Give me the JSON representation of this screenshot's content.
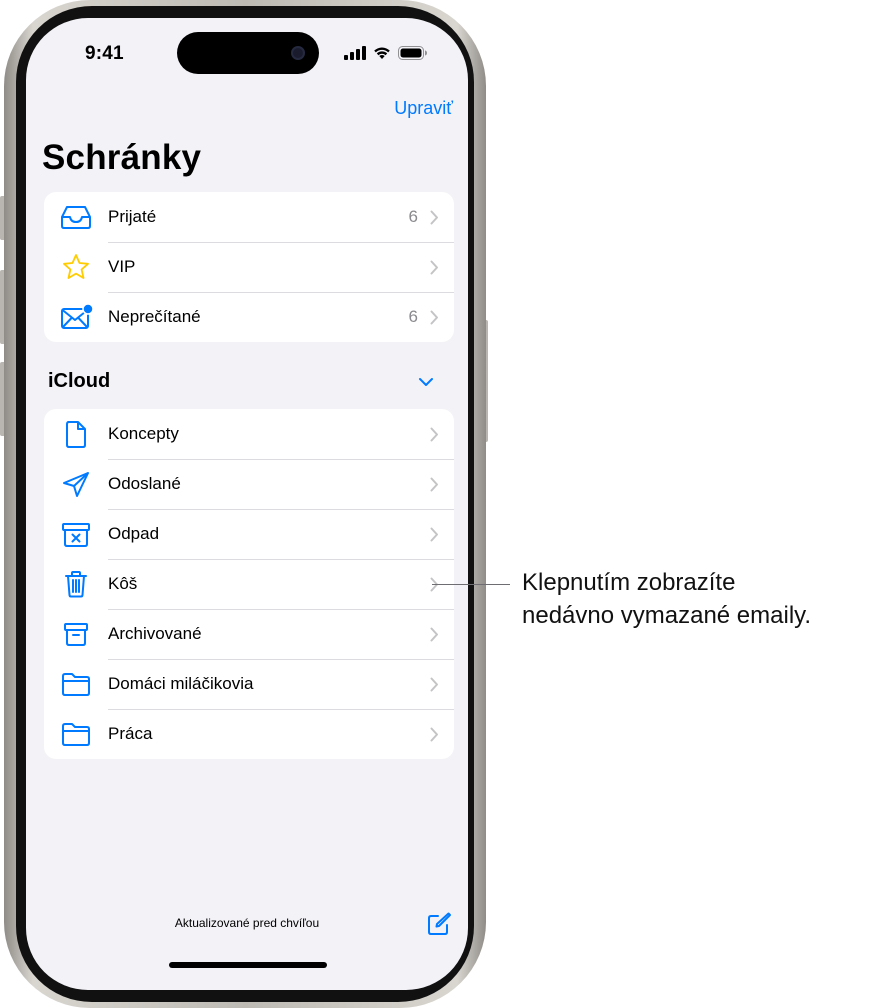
{
  "status_bar": {
    "time": "9:41"
  },
  "nav": {
    "edit_label": "Upraviť",
    "title": "Schránky"
  },
  "mailboxes": [
    {
      "label": "Prijaté",
      "count": "6",
      "icon": "inbox-tray-icon"
    },
    {
      "label": "VIP",
      "count": "",
      "icon": "star-icon"
    },
    {
      "label": "Neprečítané",
      "count": "6",
      "icon": "unread-envelope-icon"
    }
  ],
  "icloud": {
    "header": "iCloud",
    "folders": [
      {
        "label": "Koncepty",
        "icon": "draft-document-icon"
      },
      {
        "label": "Odoslané",
        "icon": "paper-plane-icon"
      },
      {
        "label": "Odpad",
        "icon": "junk-box-icon"
      },
      {
        "label": "Kôš",
        "icon": "trash-icon"
      },
      {
        "label": "Archivované",
        "icon": "archive-box-icon"
      },
      {
        "label": "Domáci miláčikovia",
        "icon": "folder-icon"
      },
      {
        "label": "Práca",
        "icon": "folder-icon"
      }
    ]
  },
  "toolbar": {
    "status_text": "Aktualizované pred chvíľou"
  },
  "callout": {
    "line1": "Klepnutím zobrazíte",
    "line2": "nedávno vymazané emaily."
  },
  "colors": {
    "accent": "#007aff",
    "vip_star": "#ffcc00",
    "screen_background": "#f2f2f7",
    "secondary_text": "#8a8a8e"
  }
}
